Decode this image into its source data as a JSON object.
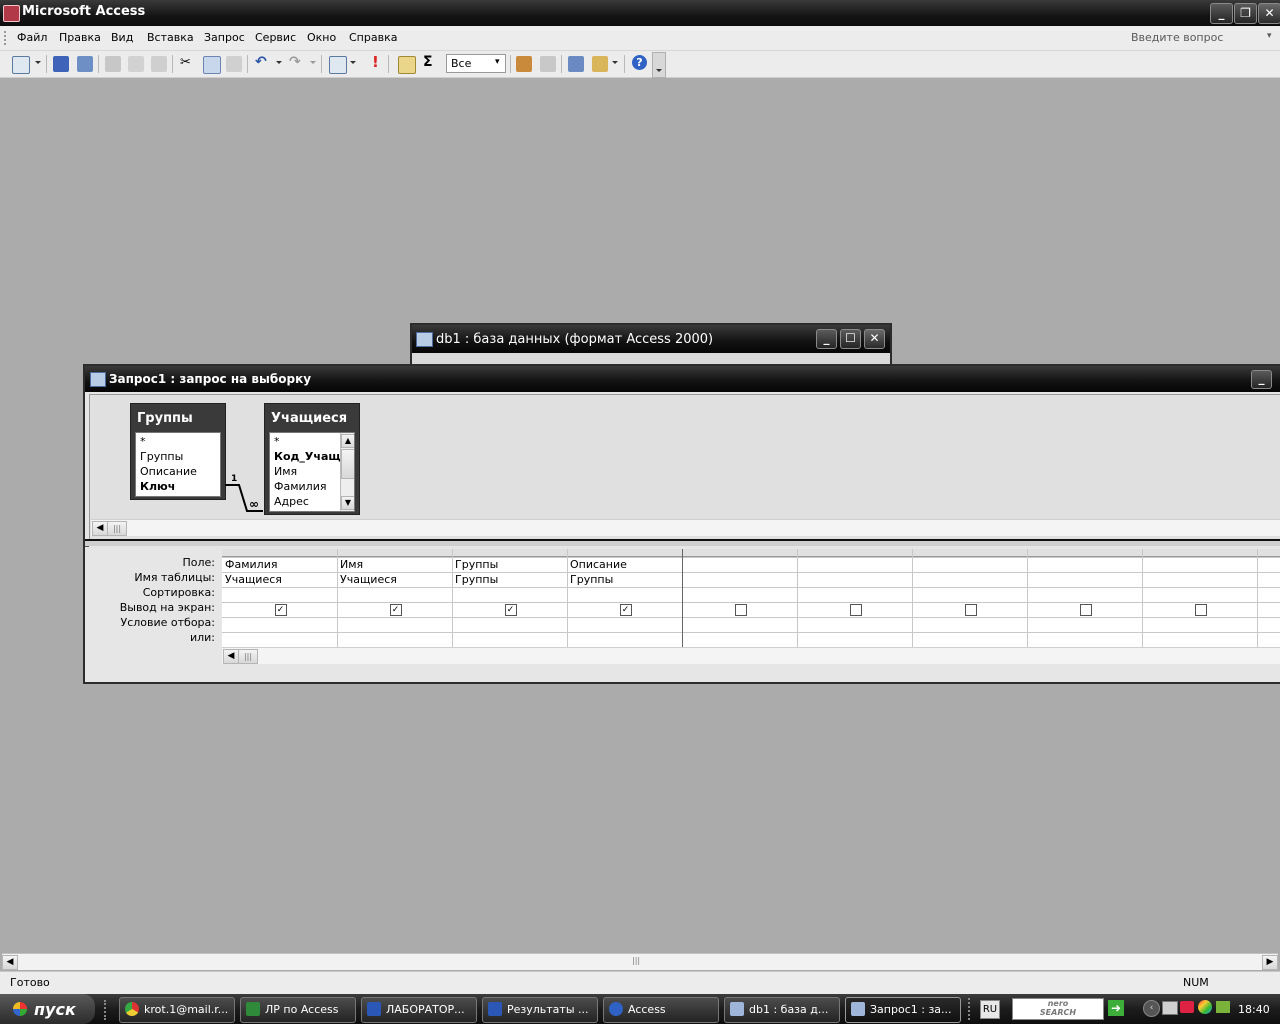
{
  "app": {
    "title": "Microsoft Access"
  },
  "menu": [
    "Файл",
    "Правка",
    "Вид",
    "Вставка",
    "Запрос",
    "Сервис",
    "Окно",
    "Справка"
  ],
  "ask_placeholder": "Введите вопрос",
  "toolbar": {
    "filter_value": "Все"
  },
  "db_window": {
    "title": "db1 : база данных (формат Access 2000)"
  },
  "query_window": {
    "title": "Запрос1 : запрос на выборку",
    "tables": [
      {
        "name": "Группы",
        "fields": [
          "*",
          "Группы",
          "Описание",
          "Ключ"
        ]
      },
      {
        "name": "Учащиеся",
        "fields": [
          "*",
          "Код_Учащие",
          "Имя",
          "Фамилия",
          "Адрес"
        ]
      }
    ],
    "relation": {
      "one": "1",
      "many": "∞"
    },
    "grid": {
      "row_labels": [
        "Поле:",
        "Имя таблицы:",
        "Сортировка:",
        "Вывод на экран:",
        "Условие отбора:",
        "или:"
      ],
      "columns": [
        {
          "field": "Фамилия",
          "table": "Учащиеся",
          "show": true
        },
        {
          "field": "Имя",
          "table": "Учащиеся",
          "show": true
        },
        {
          "field": "Группы",
          "table": "Группы",
          "show": true
        },
        {
          "field": "Описание",
          "table": "Группы",
          "show": true
        },
        {
          "field": "",
          "table": "",
          "show": false
        },
        {
          "field": "",
          "table": "",
          "show": false
        },
        {
          "field": "",
          "table": "",
          "show": false
        },
        {
          "field": "",
          "table": "",
          "show": false
        },
        {
          "field": "",
          "table": "",
          "show": false
        }
      ]
    }
  },
  "status": {
    "left": "Готово",
    "num": "NUM"
  },
  "taskbar": {
    "start": "пуск",
    "tasks": [
      "krot.1@mail.r...",
      "ЛР по Access",
      "ЛАБОРАТОР...",
      "Результаты ...",
      "Access",
      "db1 : база д...",
      "Запрос1 : за..."
    ],
    "lang": "RU",
    "nero": "nero\nSEARCH",
    "clock": "18:40"
  }
}
